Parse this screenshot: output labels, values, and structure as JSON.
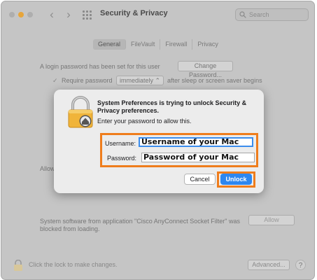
{
  "window": {
    "title": "Security & Privacy",
    "search_placeholder": "Search"
  },
  "tabs": [
    {
      "label": "General",
      "active": true
    },
    {
      "label": "FileVault",
      "active": false
    },
    {
      "label": "Firewall",
      "active": false
    },
    {
      "label": "Privacy",
      "active": false
    }
  ],
  "general": {
    "login_password_text": "A login password has been set for this user",
    "change_password_label": "Change Password...",
    "require_password_label": "Require password",
    "require_password_value": "immediately",
    "after_sleep_text": "after sleep or screen saver begins",
    "allow_text": "Allow",
    "blocked_text": "System software from application \"Cisco AnyConnect Socket Filter\" was blocked from loading.",
    "allow_button_label": "Allow"
  },
  "lock_bar": {
    "lock_text": "Click the lock to make changes.",
    "advanced_label": "Advanced...",
    "help_label": "?"
  },
  "dialog": {
    "title": "System Preferences is trying to unlock Security & Privacy preferences.",
    "subtitle": "Enter your password to allow this.",
    "username_label": "Username:",
    "username_value": "Username of your Mac",
    "password_label": "Password:",
    "password_value": "Password of your Mac",
    "cancel_label": "Cancel",
    "unlock_label": "Unlock"
  },
  "colors": {
    "accent": "#2d87f0",
    "highlight": "#ef7d1c",
    "lock_gold": "#f0b43a"
  }
}
